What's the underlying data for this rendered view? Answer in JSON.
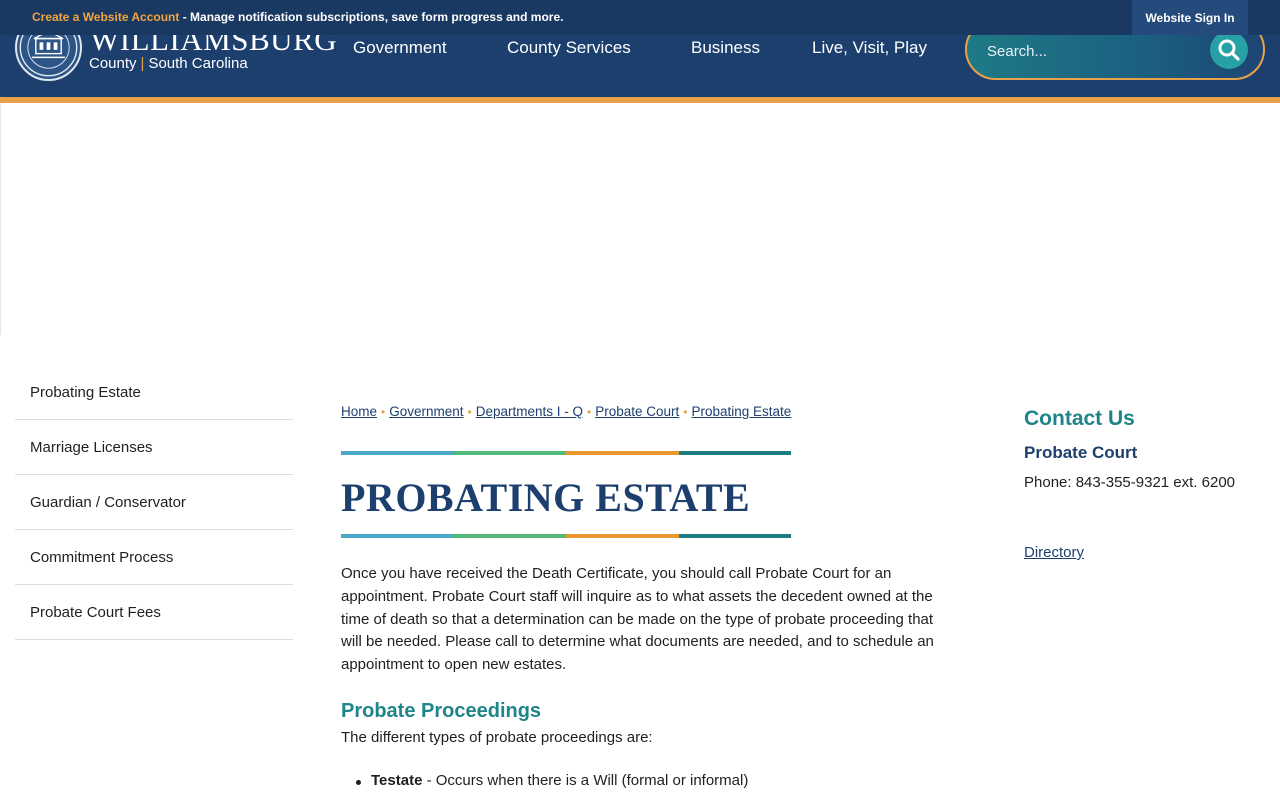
{
  "topbar": {
    "create_account": "Create a Website Account",
    "message": " - Manage notification subscriptions, save form progress and more.",
    "signin": "Website Sign In"
  },
  "logo": {
    "name": "WILLIAMSBURG",
    "county": "County",
    "state": "South Carolina"
  },
  "nav": [
    "Government",
    "County Services",
    "Business",
    "Live, Visit, Play"
  ],
  "search": {
    "placeholder": "Search..."
  },
  "sidebar": {
    "items": [
      {
        "label": "Probating Estate"
      },
      {
        "label": "Marriage Licenses"
      },
      {
        "label": "Guardian / Conservator"
      },
      {
        "label": "Commitment Process"
      },
      {
        "label": "Probate Court Fees"
      }
    ]
  },
  "breadcrumb": [
    "Home",
    "Government",
    "Departments I - Q",
    "Probate Court",
    "Probating Estate"
  ],
  "main": {
    "title": "PROBATING ESTATE",
    "intro": "Once you have received the Death Certificate, you should call Probate Court for an appointment. Probate Court staff will inquire as to what assets the decedent owned at the time of death so that a determination can be made on the type of probate proceeding that will be needed. Please call to determine what documents are needed, and to schedule an appointment to open new estates.",
    "section_heading": "Probate Proceedings",
    "section_text": "The different types of probate proceedings are:",
    "list": [
      {
        "term": "Testate",
        "desc": " - Occurs when there is a Will (formal or informal)"
      }
    ]
  },
  "contact": {
    "heading": "Contact Us",
    "department": "Probate Court",
    "phone": "Phone: 843-355-9321 ext. 6200",
    "directory": "Directory"
  },
  "colors": {
    "navy": "#1c3f6e",
    "teal": "#1f8588",
    "orange": "#e8a24a",
    "stripe": [
      "#4aa8c8",
      "#55b97c",
      "#e8982f",
      "#1d7d80"
    ]
  }
}
